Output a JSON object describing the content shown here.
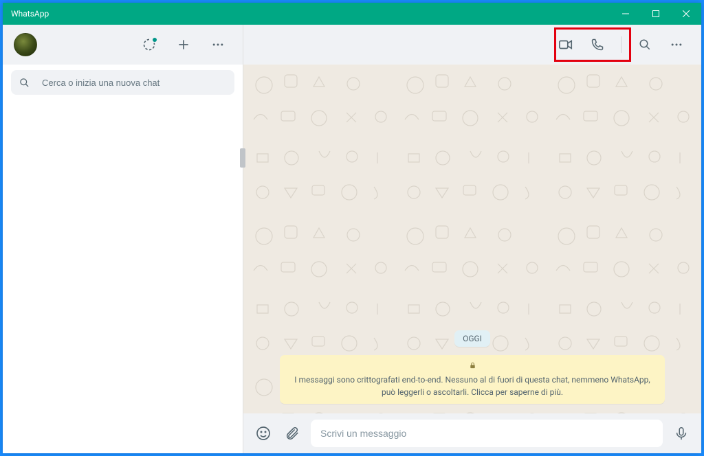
{
  "window": {
    "title": "WhatsApp"
  },
  "sidebar": {
    "search_placeholder": "Cerca o inizia una nuova chat"
  },
  "chat": {
    "date_label": "OGGI",
    "encryption_notice": "I messaggi sono crittografati end-to-end. Nessuno al di fuori di questa chat, nemmeno WhatsApp, può leggerli o ascoltarli. Clicca per saperne di più.",
    "composer_placeholder": "Scrivi un messaggio"
  },
  "colors": {
    "brand": "#00a884",
    "highlight": "#e3000f"
  }
}
